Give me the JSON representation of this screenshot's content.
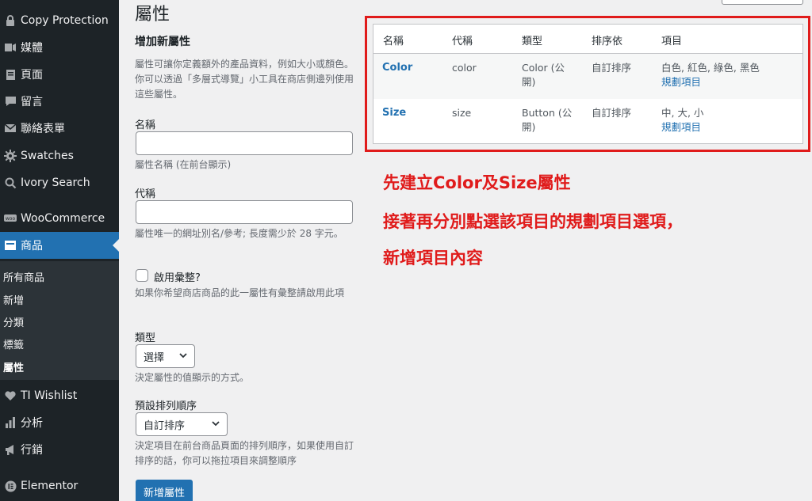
{
  "sidebar": {
    "items": [
      {
        "label": "Copy Protection",
        "icon": "lock"
      },
      {
        "label": "媒體",
        "icon": "media"
      },
      {
        "label": "頁面",
        "icon": "page"
      },
      {
        "label": "留言",
        "icon": "comment"
      },
      {
        "label": "聯絡表單",
        "icon": "mail"
      },
      {
        "label": "Swatches",
        "icon": "gear"
      },
      {
        "label": "Ivory Search",
        "icon": "search"
      },
      {
        "label": "WooCommerce",
        "icon": "woo"
      },
      {
        "label": "商品",
        "icon": "archive"
      },
      {
        "label": "TI Wishlist",
        "icon": "heart"
      },
      {
        "label": "分析",
        "icon": "chart"
      },
      {
        "label": "行銷",
        "icon": "megaphone"
      },
      {
        "label": "Elementor",
        "icon": "elementor"
      }
    ],
    "submenu": [
      "所有商品",
      "新增",
      "分類",
      "標籤",
      "屬性"
    ]
  },
  "page": {
    "title": "屬性"
  },
  "form": {
    "heading": "增加新屬性",
    "intro": "屬性可讓你定義額外的產品資料，例如大小或顏色。你可以透過「多層式導覽」小工具在商店側邊列使用這些屬性。",
    "name_label": "名稱",
    "name_value": "",
    "name_desc": "屬性名稱 (在前台顯示)",
    "slug_label": "代稱",
    "slug_value": "",
    "slug_desc": "屬性唯一的網址別名/參考; 長度需少於 28 字元。",
    "archive_label": "啟用彙整?",
    "archive_desc": "如果你希望商店商品的此一屬性有彙整請啟用此項",
    "type_label": "類型",
    "type_value": "選擇",
    "type_desc": "決定屬性的值顯示的方式。",
    "order_label": "預設排列順序",
    "order_value": "自訂排序",
    "order_desc": "決定項目在前台商品頁面的排列順序，如果使用自訂排序的話，你可以拖拉項目來調整順序",
    "submit_label": "新增屬性"
  },
  "table": {
    "headers": [
      "名稱",
      "代稱",
      "類型",
      "排序依",
      "項目"
    ],
    "rows": [
      {
        "name": "Color",
        "slug": "color",
        "type_1": "Color (公",
        "type_2": "開)",
        "order": "自訂排序",
        "terms": "白色, 紅色, 綠色, 黑色",
        "configure": "規劃項目"
      },
      {
        "name": "Size",
        "slug": "size",
        "type_1": "Button (公",
        "type_2": "開)",
        "order": "自訂排序",
        "terms": "中, 大, 小",
        "configure": "規劃項目"
      }
    ]
  },
  "annotation": {
    "line1": "先建立Color及Size屬性",
    "line2": "接著再分別點選該項目的規劃項目選項，",
    "line3": "新增項目內容"
  },
  "colors": {
    "sidebar": "#1d2327",
    "accent": "#2271b1",
    "annotation": "#e01b1b"
  }
}
